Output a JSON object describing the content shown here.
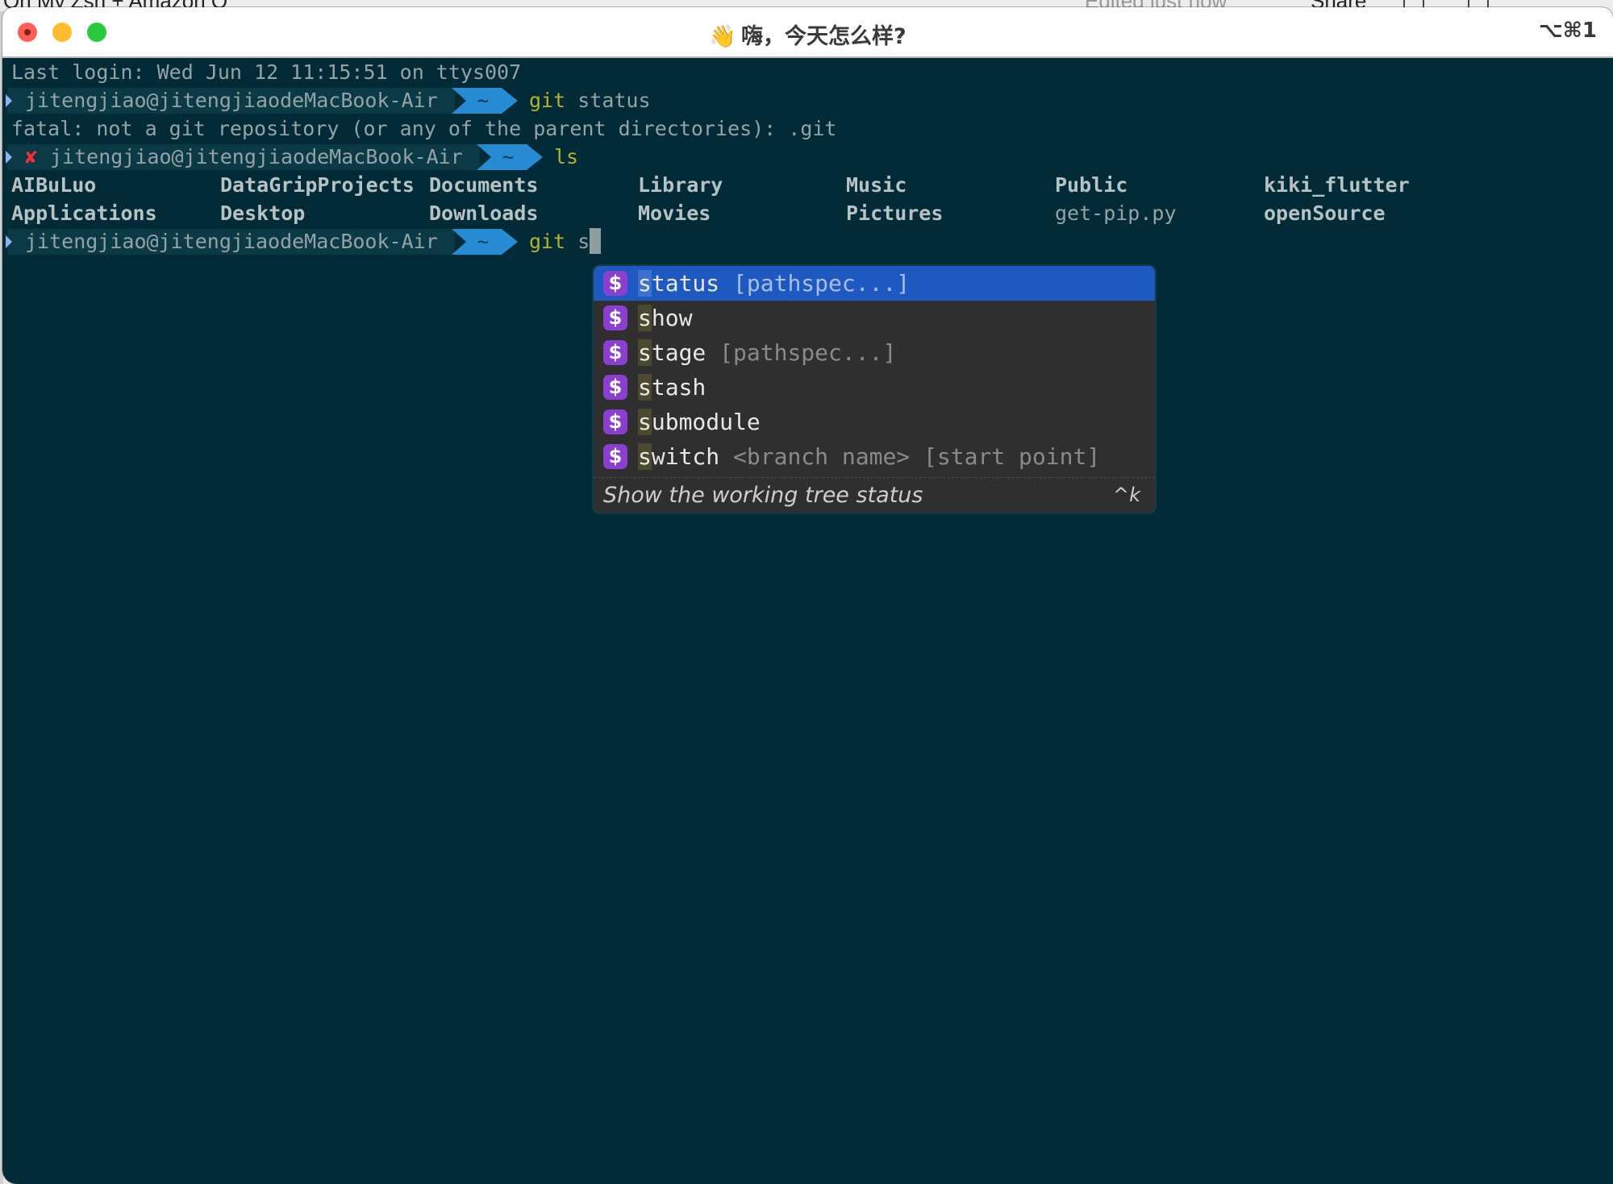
{
  "background_app": {
    "title": "Oh My Zsh + Amazon Q",
    "status": "Edited just now",
    "share_label": "Share"
  },
  "window": {
    "title_emoji": "👋",
    "title": "嗨，今天怎么样?",
    "shortcut": "⌥⌘1",
    "controls": {
      "close": "close",
      "minimize": "minimize",
      "maximize": "maximize"
    }
  },
  "terminal": {
    "colors": {
      "background": "#022b37",
      "prompt_segment": "#0b3945",
      "dir_segment": "#268bd2",
      "command": "#b3b32a",
      "error_x": "#f2303a"
    },
    "last_login": "Last login: Wed Jun 12 11:15:51 on ttys007",
    "prompts": [
      {
        "error": false,
        "user_host": "jitengjiao@jitengjiaodeMacBook-Air",
        "dir": "~",
        "command": "git",
        "args": "status"
      },
      {
        "error": true,
        "error_mark": "✘",
        "user_host": "jitengjiao@jitengjiaodeMacBook-Air",
        "dir": "~",
        "command": "ls",
        "args": ""
      },
      {
        "error": false,
        "user_host": "jitengjiao@jitengjiaodeMacBook-Air",
        "dir": "~",
        "command": "git",
        "args": "s"
      }
    ],
    "error_output": "fatal: not a git repository (or any of the parent directories): .git",
    "ls_output": {
      "row1": [
        {
          "name": "AIBuLuo",
          "type": "dir"
        },
        {
          "name": "DataGripProjects",
          "type": "dir"
        },
        {
          "name": "Documents",
          "type": "dir"
        },
        {
          "name": "Library",
          "type": "dir"
        },
        {
          "name": "Music",
          "type": "dir"
        },
        {
          "name": "Public",
          "type": "dir"
        },
        {
          "name": "kiki_flutter",
          "type": "dir"
        }
      ],
      "row2": [
        {
          "name": "Applications",
          "type": "dir"
        },
        {
          "name": "Desktop",
          "type": "dir"
        },
        {
          "name": "Downloads",
          "type": "dir"
        },
        {
          "name": "Movies",
          "type": "dir"
        },
        {
          "name": "Pictures",
          "type": "dir"
        },
        {
          "name": "get-pip.py",
          "type": "file"
        },
        {
          "name": "openSource",
          "type": "dir"
        }
      ]
    }
  },
  "autocomplete": {
    "icon": "$",
    "typed_prefix": "s",
    "selected_index": 0,
    "suggestions": [
      {
        "first": "s",
        "rest": "tatus",
        "params": "[pathspec...]"
      },
      {
        "first": "s",
        "rest": "how",
        "params": ""
      },
      {
        "first": "s",
        "rest": "tage",
        "params": "[pathspec...]"
      },
      {
        "first": "s",
        "rest": "tash",
        "params": ""
      },
      {
        "first": "s",
        "rest": "ubmodule",
        "params": ""
      },
      {
        "first": "s",
        "rest": "witch",
        "params": "<branch name> [start point]"
      }
    ],
    "description": "Show the working tree status",
    "keybinding": "^k"
  }
}
